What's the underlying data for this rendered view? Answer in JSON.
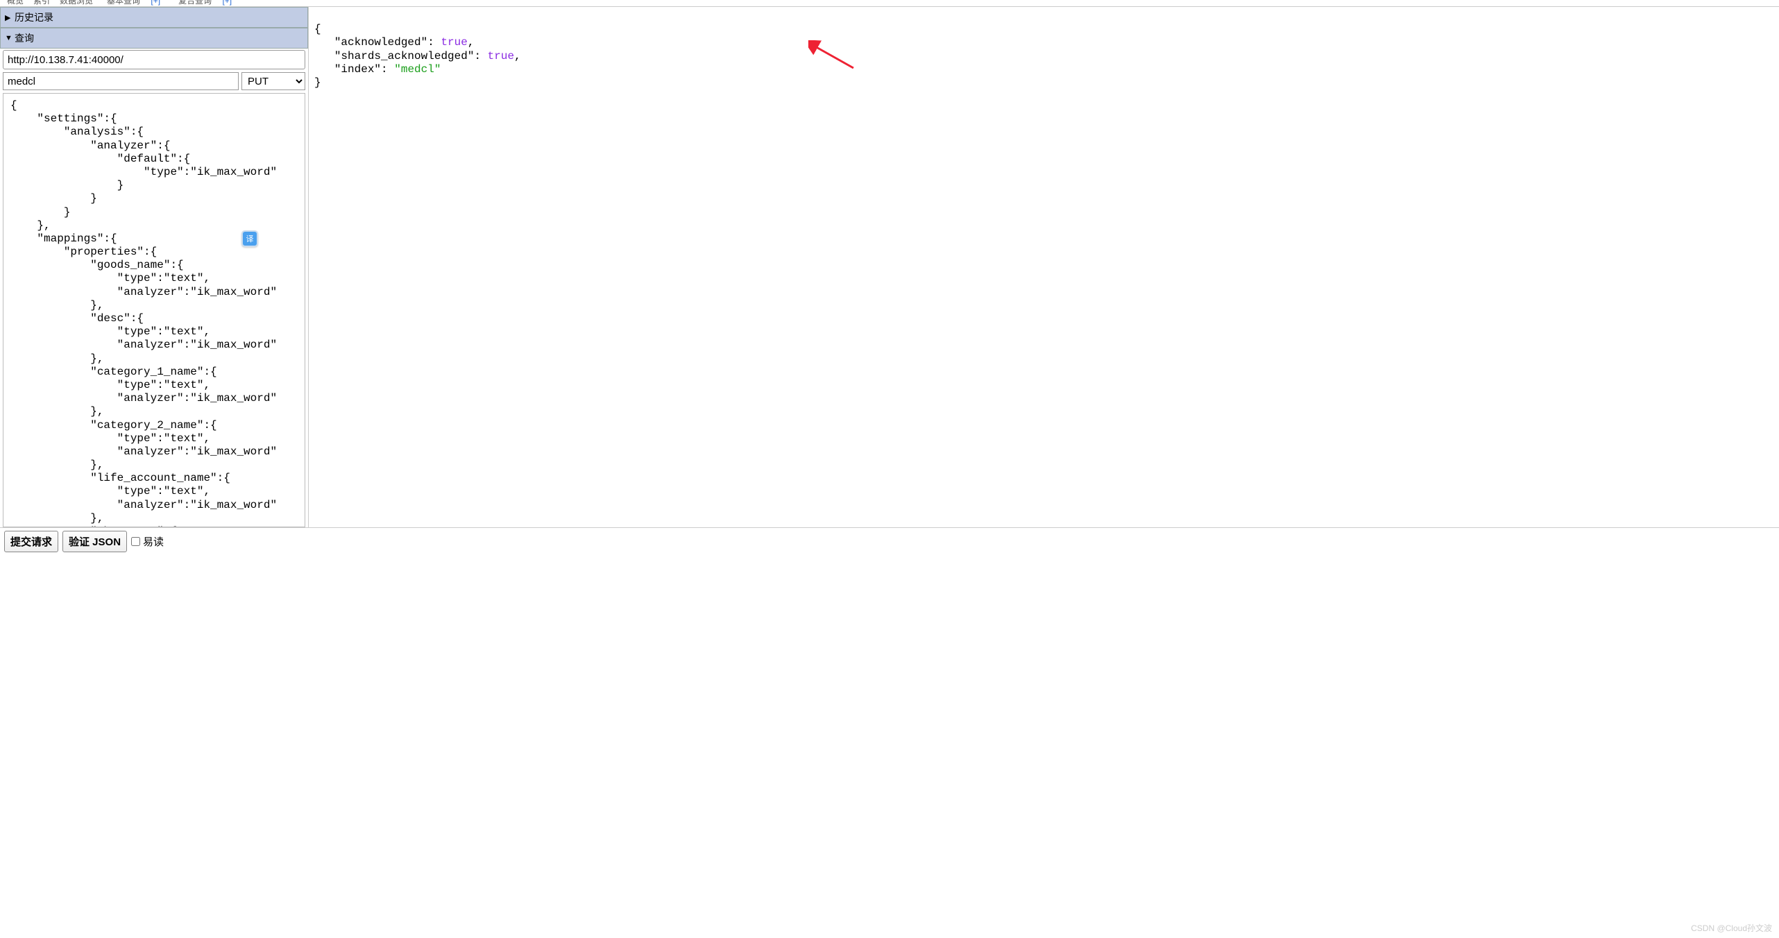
{
  "tabs": {
    "t1": "概览",
    "t2": "索引",
    "t3": "数据浏览",
    "t4": "基本查询",
    "t4_suffix": "[+]",
    "t5": "复合查询",
    "t5_suffix": "[+]"
  },
  "left": {
    "history_label": "历史记录",
    "query_label": "查询",
    "url_value": "http://10.138.7.41:40000/",
    "index_value": "medcl",
    "method_value": "PUT",
    "body_text": "{\n    \"settings\":{\n        \"analysis\":{\n            \"analyzer\":{\n                \"default\":{\n                    \"type\":\"ik_max_word\"\n                }\n            }\n        }\n    },\n    \"mappings\":{\n        \"properties\":{\n            \"goods_name\":{\n                \"type\":\"text\",\n                \"analyzer\":\"ik_max_word\"\n            },\n            \"desc\":{\n                \"type\":\"text\",\n                \"analyzer\":\"ik_max_word\"\n            },\n            \"category_1_name\":{\n                \"type\":\"text\",\n                \"analyzer\":\"ik_max_word\"\n            },\n            \"category_2_name\":{\n                \"type\":\"text\",\n                \"analyzer\":\"ik_max_word\"\n            },\n            \"life_account_name\":{\n                \"type\":\"text\",\n                \"analyzer\":\"ik_max_word\"\n            },\n            \"shop_name\":{\n                \"type\":\"text\","
  },
  "right": {
    "open": "{",
    "ack_key": "\"acknowledged\"",
    "ack_val": "true",
    "shards_key": "\"shards_acknowledged\"",
    "shards_val": "true",
    "index_key": "\"index\"",
    "index_val": "\"medcl\"",
    "close": "}"
  },
  "bottom": {
    "submit_label": "提交请求",
    "validate_label": "验证 JSON",
    "pretty_label": "易读"
  },
  "badge": {
    "translate_char": "译"
  },
  "watermark": "CSDN @Cloud孙文波"
}
